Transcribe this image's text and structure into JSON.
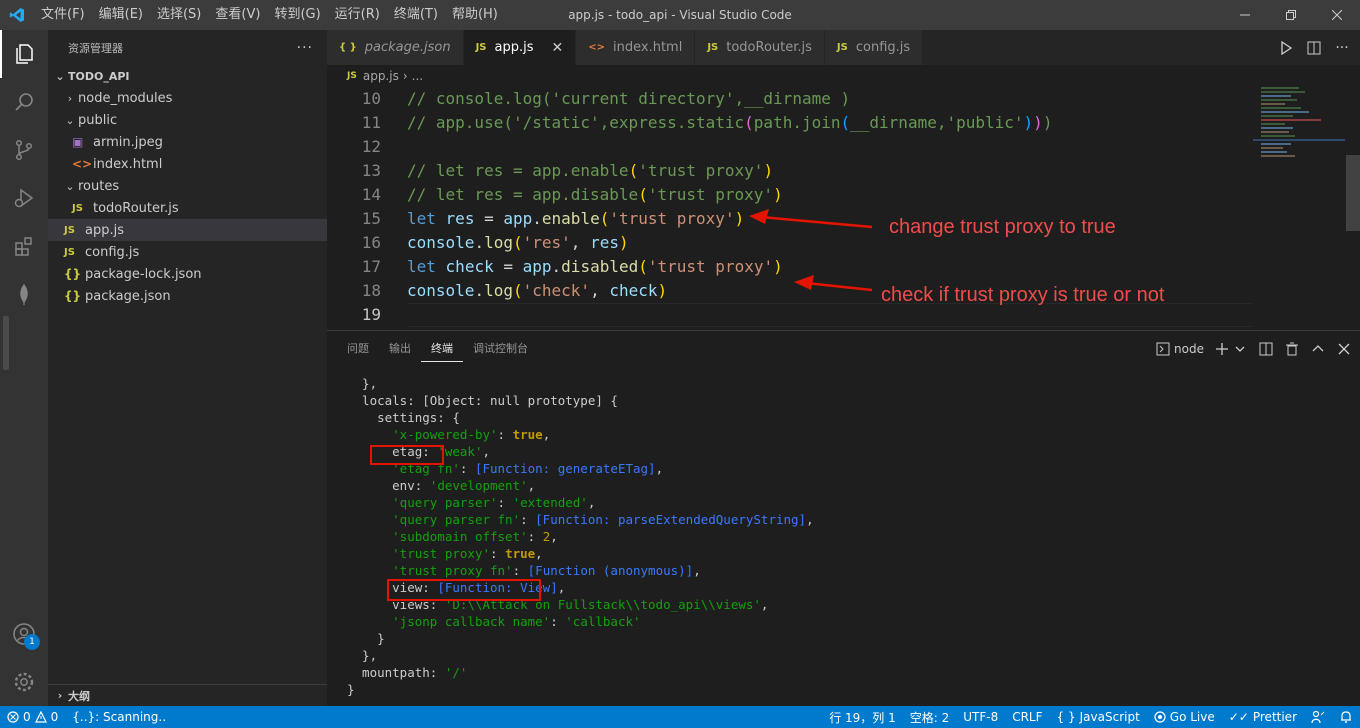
{
  "window": {
    "title": "app.js - todo_api - Visual Studio Code",
    "menu": [
      "文件(F)",
      "编辑(E)",
      "选择(S)",
      "查看(V)",
      "转到(G)",
      "运行(R)",
      "终端(T)",
      "帮助(H)"
    ]
  },
  "activity_bar": {
    "items": [
      "files-icon",
      "search-icon",
      "source-control-icon",
      "run-debug-icon",
      "extensions-icon",
      "mongodb-icon"
    ],
    "account_badge": "1"
  },
  "sidebar": {
    "title": "资源管理器",
    "more": "···",
    "root": "TODO_API",
    "items": [
      {
        "label": "node_modules",
        "kind": "folder",
        "open": false
      },
      {
        "label": "public",
        "kind": "folder",
        "open": true
      },
      {
        "label": "armin.jpeg",
        "kind": "image"
      },
      {
        "label": "index.html",
        "kind": "html"
      },
      {
        "label": "routes",
        "kind": "folder",
        "open": true
      },
      {
        "label": "todoRouter.js",
        "kind": "js"
      },
      {
        "label": "app.js",
        "kind": "js",
        "selected": true
      },
      {
        "label": "config.js",
        "kind": "js"
      },
      {
        "label": "package-lock.json",
        "kind": "json"
      },
      {
        "label": "package.json",
        "kind": "json"
      }
    ],
    "outline": "大纲"
  },
  "tabs": [
    {
      "label": "package.json",
      "icon": "{ }",
      "active": false,
      "italic": true
    },
    {
      "label": "app.js",
      "icon": "JS",
      "active": true,
      "close": "✕"
    },
    {
      "label": "index.html",
      "icon": "<>",
      "active": false
    },
    {
      "label": "todoRouter.js",
      "icon": "JS",
      "active": false
    },
    {
      "label": "config.js",
      "icon": "JS",
      "active": false
    }
  ],
  "breadcrumb": {
    "icon": "JS",
    "file": "app.js",
    "sep": "›",
    "more": "..."
  },
  "code": {
    "lines": [
      {
        "n": "10",
        "text": "// console.log('current directory',__dirname )"
      },
      {
        "n": "11",
        "text": "// app.use('/static',express.static(path.join(__dirname,'public')))"
      },
      {
        "n": "12",
        "text": ""
      },
      {
        "n": "13",
        "text": "// let res = app.enable('trust proxy')"
      },
      {
        "n": "14",
        "text": "// let res = app.disable('trust proxy')"
      },
      {
        "n": "15",
        "text": "let res = app.enable('trust proxy')"
      },
      {
        "n": "16",
        "text": "console.log('res', res)"
      },
      {
        "n": "17",
        "text": "let check = app.disabled('trust proxy')"
      },
      {
        "n": "18",
        "text": "console.log('check', check)"
      },
      {
        "n": "19",
        "text": ""
      }
    ]
  },
  "annotations": {
    "a1": "change trust proxy to true",
    "a2": "check if trust proxy is true or not"
  },
  "panel": {
    "tabs": [
      "问题",
      "输出",
      "终端",
      "调试控制台"
    ],
    "active_tab": "终端",
    "terminal_name": "node"
  },
  "terminal": {
    "lines": [
      "  },",
      "  locals: [Object: null prototype] {",
      "    settings: {",
      "      'x-powered-by': true,",
      "      etag: 'weak',",
      "      'etag fn': [Function: generateETag],",
      "      env: 'development',",
      "      'query parser': 'extended',",
      "      'query parser fn': [Function: parseExtendedQueryString],",
      "      'subdomain offset': 2,",
      "      'trust proxy': true,",
      "      'trust proxy fn': [Function (anonymous)],",
      "      view: [Function: View],",
      "      views: 'D:\\\\Attack on Fullstack\\\\todo_api\\\\views',",
      "      'jsonp callback name': 'callback'",
      "    }",
      "  },",
      "  mountpath: '/'",
      "}"
    ]
  },
  "statusbar": {
    "errors": "0",
    "warnings": "0",
    "scanning": "{..}: Scanning..",
    "position": "行 19，列 1",
    "spaces": "空格: 2",
    "encoding": "UTF-8",
    "eol": "CRLF",
    "language": "JavaScript",
    "golive": "Go Live",
    "prettier": "Prettier"
  }
}
